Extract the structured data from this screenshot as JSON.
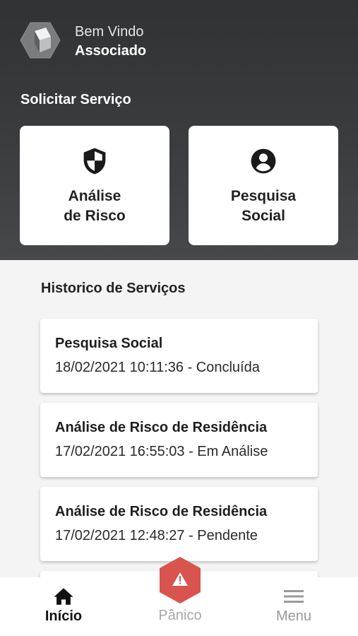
{
  "header": {
    "greeting": "Bem Vindo",
    "user": "Associado",
    "logo_icon": "hexagon-cube-logo"
  },
  "services": {
    "title": "Solicitar Serviço",
    "items": [
      {
        "label": "Análise\nde Risco",
        "icon": "shield-icon"
      },
      {
        "label": "Pesquisa\nSocial",
        "icon": "account-circle-icon"
      }
    ]
  },
  "history": {
    "title": "Historico de Serviços",
    "items": [
      {
        "title": "Pesquisa Social",
        "detail": "18/02/2021 10:11:36 - Concluída"
      },
      {
        "title": "Análise de Risco de Residência",
        "detail": "17/02/2021 16:55:03 - Em Análise"
      },
      {
        "title": "Análise de Risco de Residência",
        "detail": "17/02/2021 12:48:27 - Pendente"
      }
    ]
  },
  "nav": {
    "home_label": "Início",
    "panic_label": "Pânico",
    "menu_label": "Menu"
  },
  "colors": {
    "header_dark": "#303234",
    "panic_red": "#d9534f",
    "active": "#111111",
    "inactive": "#9a9a9a"
  }
}
